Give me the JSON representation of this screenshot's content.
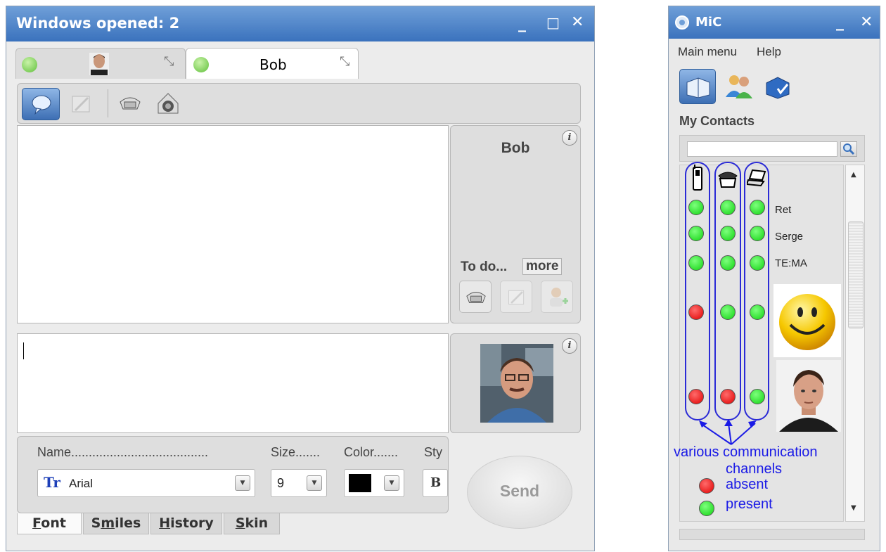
{
  "chat_window": {
    "title": "Windows opened: 2",
    "tabs": [
      {
        "label": ""
      },
      {
        "label": "Bob"
      }
    ],
    "contact_panel": {
      "name": "Bob",
      "info_icon": "i",
      "todo_label": "To do...",
      "more_label": "more"
    },
    "avatar_info_icon": "i",
    "format_bar": {
      "name_label": "Name.......................................",
      "size_label": "Size.......",
      "color_label": "Color.......",
      "style_label": "Sty",
      "font_value": "Arial",
      "size_value": "9",
      "color_value": "#000000",
      "style_button": "B"
    },
    "send_label": "Send",
    "bottom_tabs": [
      "Font",
      "Smiles",
      "History",
      "Skin"
    ],
    "bottom_tab_accesskeys": [
      "F",
      "m",
      "H",
      "S"
    ]
  },
  "mic_window": {
    "title": "MiC",
    "menu": [
      "Main menu",
      "Help"
    ],
    "section_title": "My Contacts",
    "search_placeholder": "",
    "contacts": [
      "Ret",
      "Serge",
      "TE:MA"
    ],
    "channels": [
      "mobile-phone-icon",
      "desk-phone-icon",
      "laptop-icon"
    ],
    "status_rows": [
      [
        "present",
        "present",
        "present"
      ],
      [
        "present",
        "present",
        "present"
      ],
      [
        "present",
        "present",
        "present"
      ],
      [
        "absent",
        "present",
        "present"
      ],
      [
        "absent",
        "absent",
        "present"
      ]
    ],
    "annotation": {
      "line1": "various communication",
      "line2": "channels",
      "absent_label": "absent",
      "present_label": "present"
    },
    "colors": {
      "present": "#11d311",
      "absent": "#e00000",
      "annotation": "#1a1ae6"
    }
  }
}
